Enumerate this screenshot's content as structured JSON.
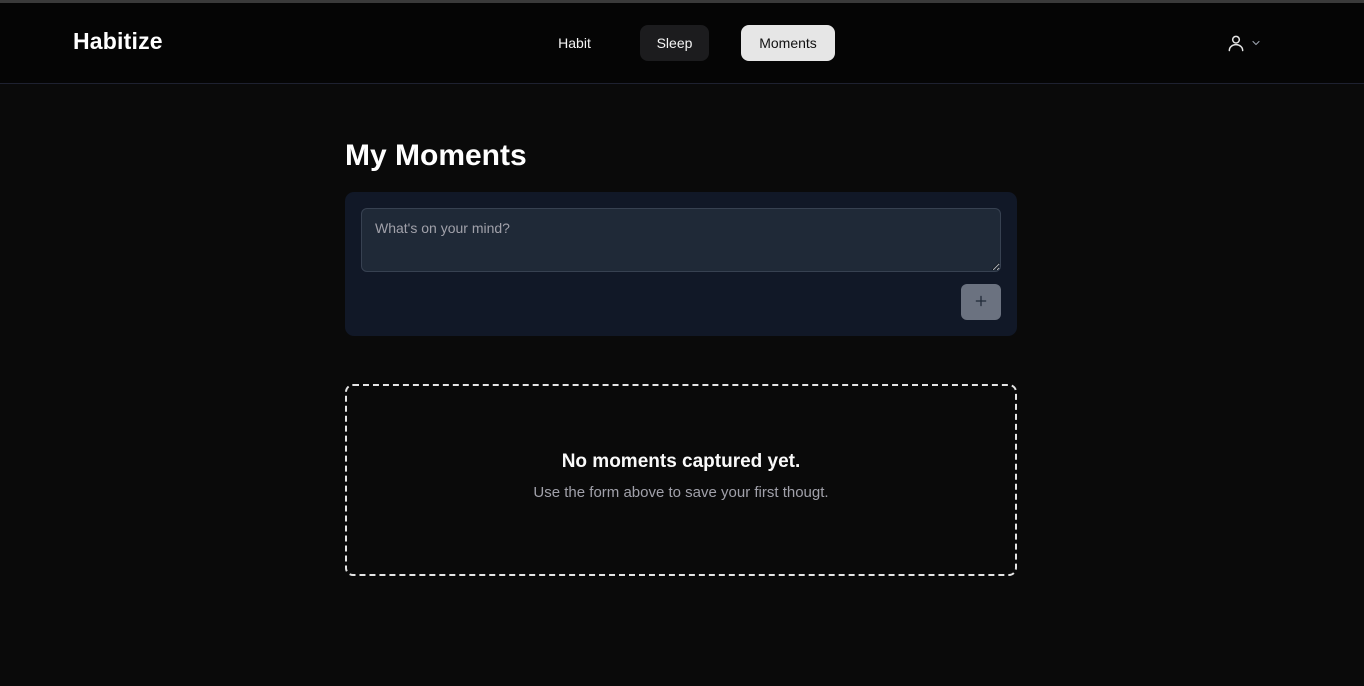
{
  "app": {
    "brand": "Habitize"
  },
  "nav": {
    "habit_label": "Habit",
    "sleep_label": "Sleep",
    "moments_label": "Moments",
    "active": "Moments"
  },
  "user_menu": {
    "icon": "user-icon",
    "chevron": "chevron-down-icon"
  },
  "page": {
    "title": "My Moments"
  },
  "composer": {
    "placeholder": "What's on your mind?",
    "value": "",
    "add_icon": "plus-icon"
  },
  "empty_state": {
    "title": "No moments captured yet.",
    "subtitle": "Use the form above to save your first thougt."
  },
  "colors": {
    "background": "#0a0a0a",
    "header": "#050505",
    "card": "#111827",
    "active_tab": "#e6e6e6",
    "add_button": "#6b7280"
  }
}
